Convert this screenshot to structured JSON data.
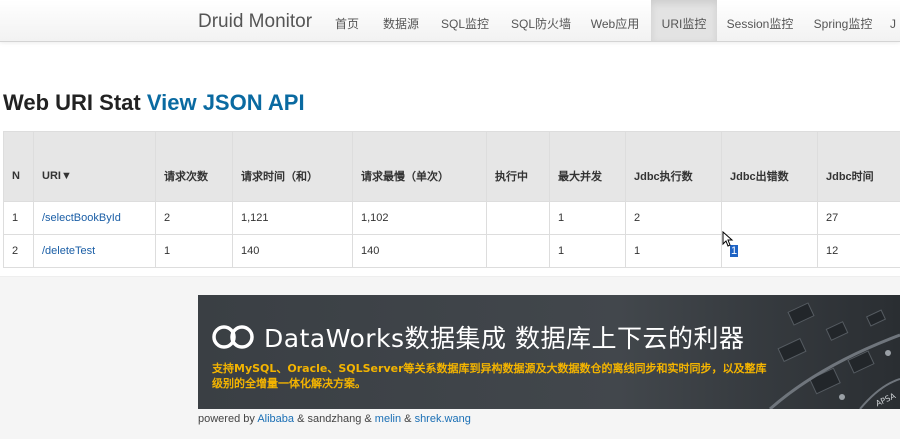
{
  "nav": {
    "brand": "Druid Monitor",
    "items": [
      {
        "label": "首页"
      },
      {
        "label": "数据源"
      },
      {
        "label": "SQL监控"
      },
      {
        "label": "SQL防火墙"
      },
      {
        "label": "Web应用"
      },
      {
        "label": "URI监控",
        "active": true
      },
      {
        "label": "Session监控"
      },
      {
        "label": "Spring监控"
      },
      {
        "label": "J"
      }
    ]
  },
  "page": {
    "title": "Web URI Stat",
    "json_link": "View JSON API"
  },
  "table": {
    "headers": [
      "N",
      "URI▼",
      "请求次数",
      "请求时间（和）",
      "请求最慢（单次）",
      "执行中",
      "最大并发",
      "Jdbc执行数",
      "Jdbc出错数",
      "Jdbc时间"
    ],
    "rows": [
      [
        "1",
        "/selectBookById",
        "2",
        "1,121",
        "1,102",
        "",
        "1",
        "2",
        "",
        "27"
      ],
      [
        "2",
        "/deleteTest",
        "1",
        "140",
        "140",
        "",
        "1",
        "1",
        "1",
        "12"
      ]
    ]
  },
  "ad": {
    "headline": "DataWorks数据集成 数据库上下云的利器",
    "subtext": "支持MySQL、Oracle、SQLServer等关系数据库到异构数据源及大数据数仓的离线同步和实时同步，以及整库级别的全增量一体化解决方案。",
    "chip_label": "APSA"
  },
  "footer": {
    "prefix": "powered by",
    "alibaba": "Alibaba",
    "amp1": "&",
    "sandzhang": "sandzhang",
    "amp2": "&",
    "melin": "melin",
    "amp3": "&",
    "shrek": "shrek.wang"
  }
}
